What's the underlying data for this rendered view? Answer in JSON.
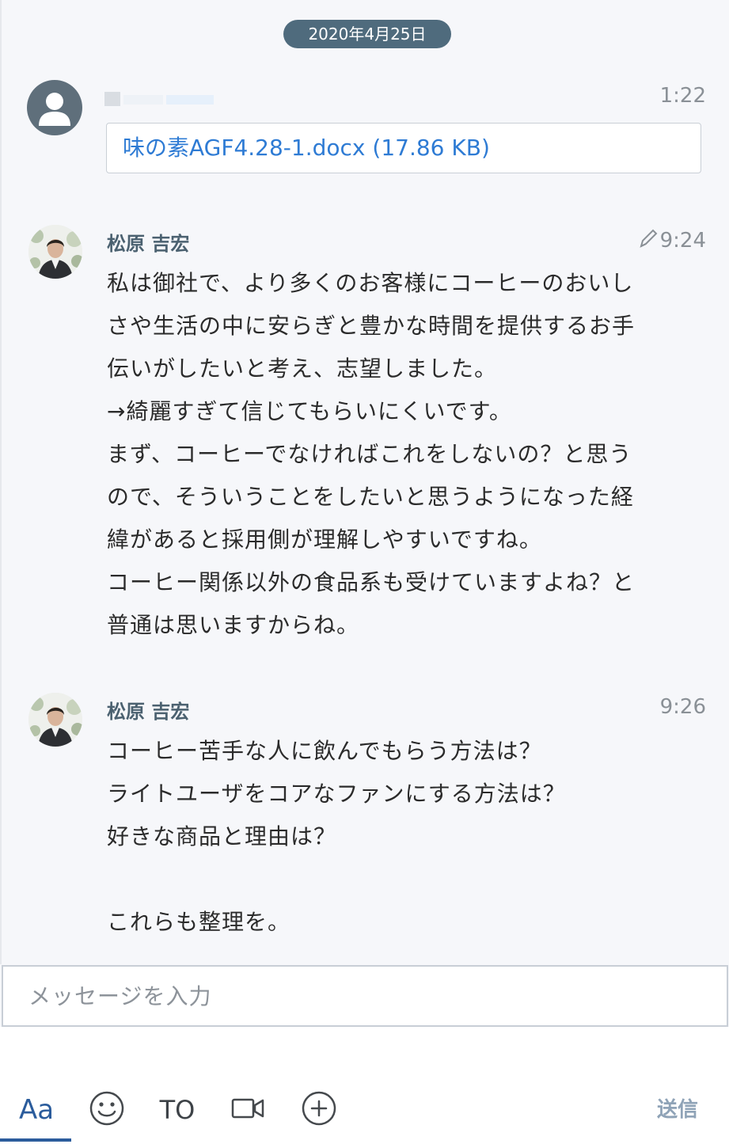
{
  "date_separator": "2020年4月25日",
  "messages": [
    {
      "sender": "",
      "time": "1:22",
      "attachment": "味の素AGF4.28-1.docx (17.86 KB)",
      "avatar": "default-user-icon"
    },
    {
      "sender": "松原 吉宏",
      "time": "9:24",
      "edited_icon": "pencil-icon",
      "avatar": "photo",
      "lines": [
        "私は御社で、より多くのお客様にコーヒーのおいし",
        "さや生活の中に安らぎと豊かな時間を提供するお手",
        "伝いがしたいと考え、志望しました。",
        "→綺麗すぎて信じてもらいにくいです。",
        "まず、コーヒーでなければこれをしないの？と思う",
        "ので、そういうことをしたいと思うようになった経",
        "緯があると採用側が理解しやすいですね。",
        "コーヒー関係以外の食品系も受けていますよね？と",
        "普通は思いますからね。"
      ]
    },
    {
      "sender": "松原 吉宏",
      "time": "9:26",
      "avatar": "photo",
      "lines": [
        "コーヒー苦手な人に飲んでもらう方法は？",
        "ライトユーザをコアなファンにする方法は？",
        "好きな商品と理由は？",
        "",
        "これらも整理を。"
      ]
    }
  ],
  "composer": {
    "placeholder": "メッセージを入力",
    "value": ""
  },
  "toolbar": {
    "format_label": "Aa",
    "emoji_icon": "smiley-icon",
    "to_label": "TO",
    "video_icon": "video-camera-icon",
    "add_icon": "plus-circle-icon",
    "send_label": "送信"
  },
  "colors": {
    "accent": "#2b5c9c",
    "date_pill": "#4f6b7d",
    "link": "#2e7bd4",
    "sender": "#4b6170"
  }
}
